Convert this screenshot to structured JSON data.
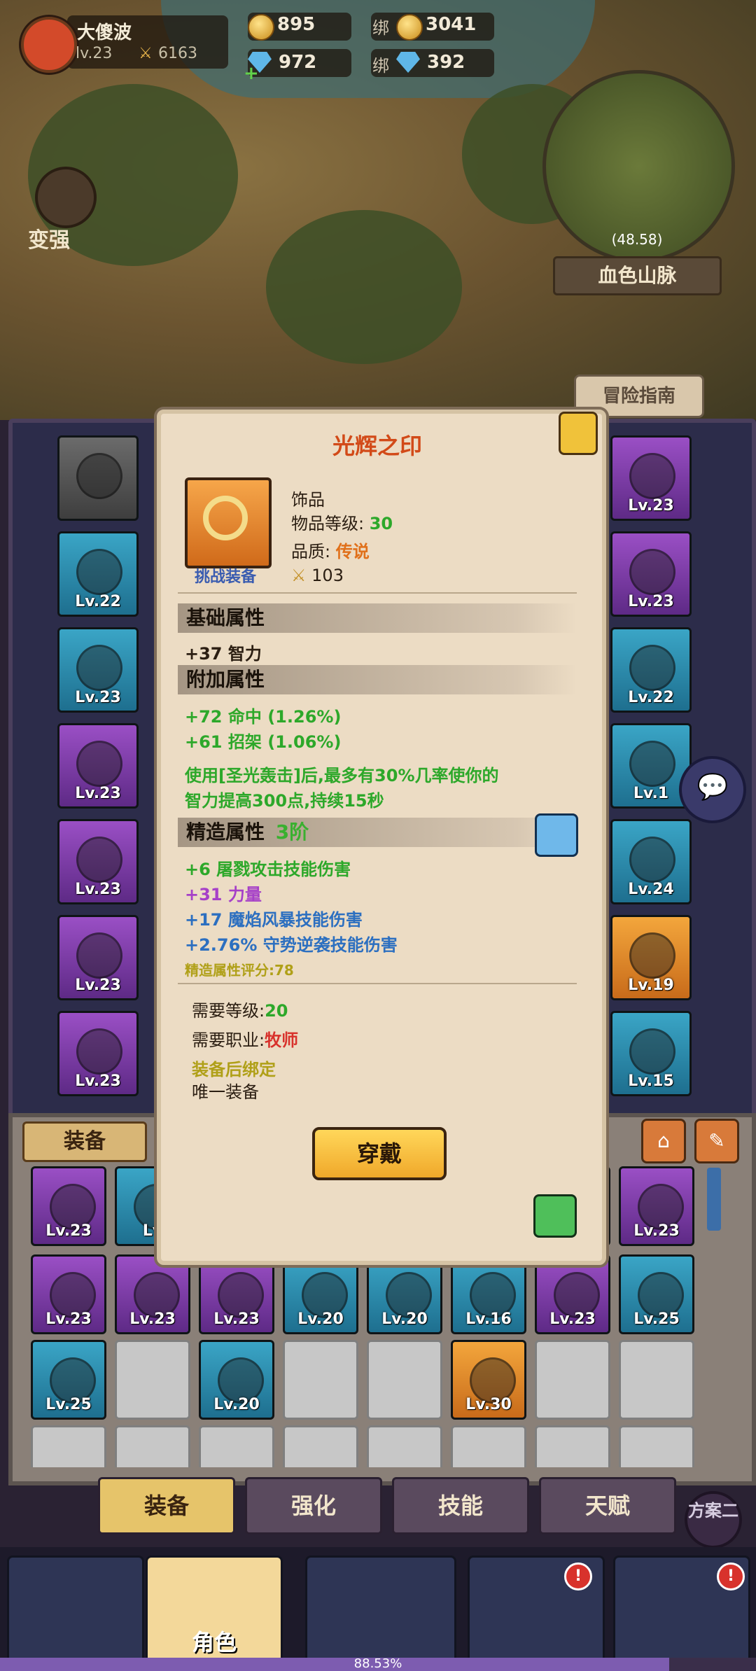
{
  "player": {
    "name": "大傻波",
    "level": "lv.23",
    "power": "6163"
  },
  "resources": {
    "gold": "895",
    "bound_gold_label": "绑",
    "bound_gold": "3041",
    "gems": "972",
    "bound_gems_label": "绑",
    "bound_gems": "392"
  },
  "map": {
    "coords": "(48.58)",
    "zone": "血色山脉",
    "strengthen": "变强",
    "guide": "冒险指南"
  },
  "left_slots": [
    {
      "level": "",
      "rarity": "grey"
    },
    {
      "level": "Lv.22",
      "rarity": "blue"
    },
    {
      "level": "Lv.23",
      "rarity": "blue"
    },
    {
      "level": "Lv.23",
      "rarity": "purple"
    },
    {
      "level": "Lv.23",
      "rarity": "purple"
    },
    {
      "level": "Lv.23",
      "rarity": "purple"
    },
    {
      "level": "Lv.23",
      "rarity": "purple"
    }
  ],
  "right_slots": [
    {
      "level": "Lv.23",
      "rarity": "purple"
    },
    {
      "level": "Lv.23",
      "rarity": "purple"
    },
    {
      "level": "Lv.22",
      "rarity": "blue"
    },
    {
      "level": "Lv.1",
      "rarity": "blue"
    },
    {
      "level": "Lv.24",
      "rarity": "blue"
    },
    {
      "level": "Lv.19",
      "rarity": "orange"
    },
    {
      "level": "Lv.15",
      "rarity": "blue"
    }
  ],
  "bag": {
    "tab_label": "装备",
    "row1": [
      {
        "level": "Lv.23",
        "rarity": "purple"
      },
      {
        "level": "Lv",
        "rarity": "blue"
      },
      {
        "level": "Lv.23",
        "rarity": "purple"
      }
    ],
    "row2": [
      {
        "level": "Lv.23",
        "rarity": "purple"
      },
      {
        "level": "Lv.23",
        "rarity": "purple"
      },
      {
        "level": "Lv.23",
        "rarity": "purple"
      },
      {
        "level": "Lv.20",
        "rarity": "blue"
      },
      {
        "level": "Lv.20",
        "rarity": "blue"
      },
      {
        "level": "Lv.16",
        "rarity": "blue"
      },
      {
        "level": "Lv.23",
        "rarity": "purple"
      },
      {
        "level": "Lv.25",
        "rarity": "blue"
      }
    ],
    "row3": [
      {
        "level": "Lv.25",
        "rarity": "blue"
      },
      {
        "level": "",
        "rarity": "empty"
      },
      {
        "level": "Lv.20",
        "rarity": "blue"
      },
      {
        "level": "",
        "rarity": "empty"
      },
      {
        "level": "",
        "rarity": "empty"
      },
      {
        "level": "Lv.30",
        "rarity": "orange"
      },
      {
        "level": "",
        "rarity": "empty"
      },
      {
        "level": "",
        "rarity": "empty"
      }
    ]
  },
  "tabs": [
    "装备",
    "强化",
    "技能",
    "天赋"
  ],
  "plan_label": "方案二",
  "bottom_nav": {
    "character": "角色"
  },
  "xp": {
    "text": "88.53%",
    "fraction": 0.8853
  },
  "tooltip": {
    "title": "光辉之印",
    "item_type": "饰品",
    "item_level_label": "物品等级:",
    "item_level": "30",
    "quality_label": "品质:",
    "quality": "传说",
    "power": "103",
    "challenge": "挑战装备",
    "base_header": "基础属性",
    "base_stats": [
      "+37 智力"
    ],
    "extra_header": "附加属性",
    "extra_stats": [
      "+72 命中 (1.26%)",
      "+61 招架 (1.06%)"
    ],
    "extra_desc_1": "使用[圣光轰击]后,最多有30%几率使你的",
    "extra_desc_2": "智力提高300点,持续15秒",
    "refine_header": "精造属性",
    "refine_tier": "3阶",
    "refine_stats": [
      {
        "text": "+6 屠戮攻击技能伤害",
        "color": "green"
      },
      {
        "text": "+31 力量",
        "color": "purple"
      },
      {
        "text": "+17 魔焰风暴技能伤害",
        "color": "blue"
      },
      {
        "text": "+2.76% 守势逆袭技能伤害",
        "color": "blue"
      }
    ],
    "refine_score": "精造属性评分:78",
    "req_level_label": "需要等级:",
    "req_level": "20",
    "req_class_label": "需要职业:",
    "req_class": "牧师",
    "bind_text": "装备后绑定",
    "unique_text": "唯一装备",
    "wear_button": "穿戴"
  }
}
